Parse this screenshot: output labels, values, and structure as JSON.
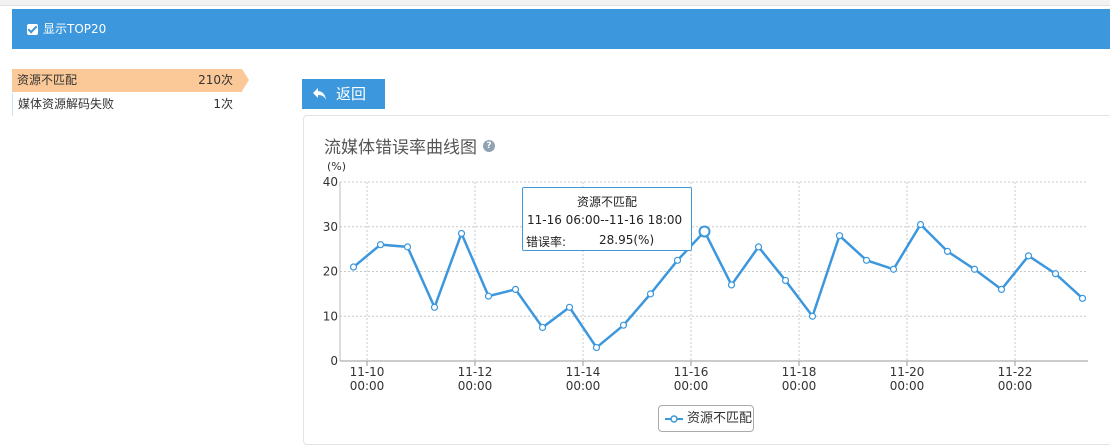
{
  "header": {
    "toggle_label": "显示TOP20",
    "checked": true
  },
  "left_list": [
    {
      "label": "资源不匹配",
      "count": "210次",
      "active": true
    },
    {
      "label": "媒体资源解码失败",
      "count": "1次",
      "active": false
    }
  ],
  "back_button": {
    "label": "返回",
    "icon": "back-arrow-icon"
  },
  "panel": {
    "title": "流媒体错误率曲线图",
    "help_icon": "question-icon"
  },
  "tooltip": {
    "title": "资源不匹配",
    "range": "11-16 06:00--11-16 18:00",
    "label": "错误率:",
    "value": "28.95(%)"
  },
  "legend": {
    "label": "资源不匹配"
  },
  "colors": {
    "accent": "#3c97dd",
    "active_item": "#fbc998",
    "series": "#3c97dd"
  },
  "chart_data": {
    "type": "line",
    "y_unit": "(%)",
    "ylim": [
      0,
      40
    ],
    "y_ticks": [
      "0",
      "10",
      "20",
      "30",
      "40"
    ],
    "x_ticks": [
      {
        "date": "11-10",
        "time": "00:00"
      },
      {
        "date": "11-12",
        "time": "00:00"
      },
      {
        "date": "11-14",
        "time": "00:00"
      },
      {
        "date": "11-16",
        "time": "00:00"
      },
      {
        "date": "11-18",
        "time": "00:00"
      },
      {
        "date": "11-20",
        "time": "00:00"
      },
      {
        "date": "11-22",
        "time": "00:00"
      }
    ],
    "grid": true,
    "highlight_index": 13,
    "series": [
      {
        "name": "资源不匹配",
        "x": [
          "11-09 18:00",
          "11-10 06:00",
          "11-10 18:00",
          "11-11 06:00",
          "11-11 18:00",
          "11-12 06:00",
          "11-12 18:00",
          "11-13 06:00",
          "11-13 18:00",
          "11-14 06:00",
          "11-14 18:00",
          "11-15 06:00",
          "11-15 18:00",
          "11-16 06:00",
          "11-16 18:00",
          "11-17 06:00",
          "11-17 18:00",
          "11-18 06:00",
          "11-18 18:00",
          "11-19 06:00",
          "11-19 18:00",
          "11-20 06:00",
          "11-20 18:00",
          "11-21 06:00",
          "11-21 18:00",
          "11-22 06:00",
          "11-22 18:00",
          "11-23 06:00"
        ],
        "values": [
          21,
          26,
          25.5,
          12,
          28.5,
          14.5,
          16,
          7.5,
          12,
          3,
          8,
          15,
          22.5,
          28.95,
          17,
          25.5,
          18,
          10,
          28,
          22.5,
          20.5,
          30.5,
          24.5,
          20.5,
          16,
          23.5,
          19.5,
          14
        ]
      }
    ]
  }
}
